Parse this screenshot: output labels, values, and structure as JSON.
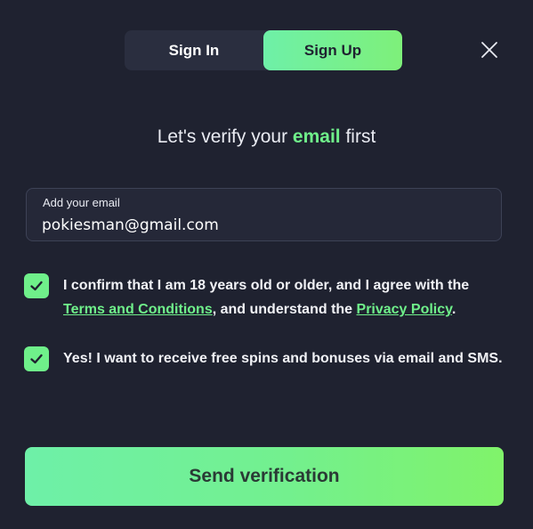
{
  "tabs": {
    "sign_in": "Sign In",
    "sign_up": "Sign Up",
    "active": "sign_up"
  },
  "close": {
    "icon": "close-icon"
  },
  "heading": {
    "prefix": "Let's verify your ",
    "accent": "email",
    "suffix": " first"
  },
  "email": {
    "label": "Add your email",
    "value": "pokiesman@gmail.com"
  },
  "consent": {
    "checked": true,
    "text_before": "I confirm that I am 18 years old or older, and I agree with the ",
    "terms_link": "Terms and Conditions",
    "text_middle": ", and understand the ",
    "privacy_link": "Privacy Policy",
    "text_after": "."
  },
  "marketing": {
    "checked": true,
    "text": "Yes! I want to receive free spins and bonuses via email and SMS."
  },
  "submit": {
    "label": "Send verification"
  },
  "colors": {
    "background": "#1f2230",
    "accent": "#6ff08a",
    "accent_gradient_start": "#6ef0a8",
    "accent_gradient_end": "#80f36a"
  }
}
